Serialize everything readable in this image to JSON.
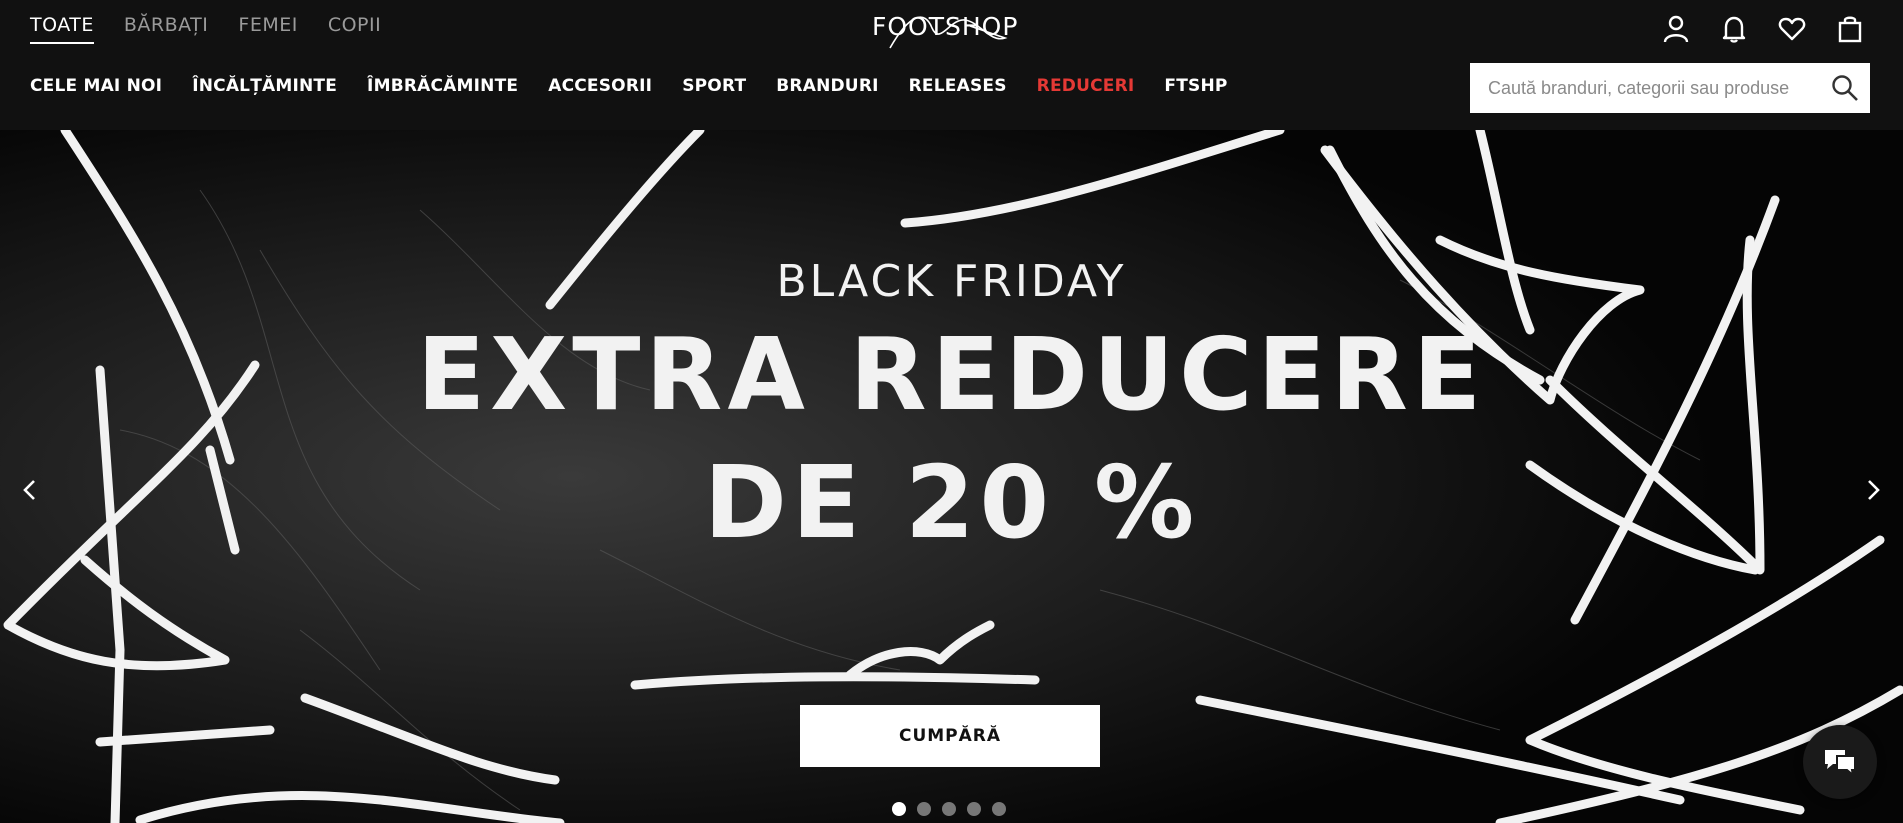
{
  "gender_tabs": [
    {
      "label": "TOATE",
      "active": true
    },
    {
      "label": "BĂRBAȚI",
      "active": false
    },
    {
      "label": "FEMEI",
      "active": false
    },
    {
      "label": "COPII",
      "active": false
    }
  ],
  "logo": {
    "text": "FOOTSHOP"
  },
  "top_icons": [
    "user-icon",
    "bell-icon",
    "heart-icon",
    "bag-icon"
  ],
  "nav": [
    {
      "label": "CELE MAI NOI"
    },
    {
      "label": "ÎNCĂLȚĂMINTE"
    },
    {
      "label": "ÎMBRĂCĂMINTE"
    },
    {
      "label": "ACCESORII"
    },
    {
      "label": "SPORT"
    },
    {
      "label": "BRANDURI"
    },
    {
      "label": "RELEASES"
    },
    {
      "label": "REDUCERI",
      "highlight": "#e53935"
    },
    {
      "label": "FTSHP"
    }
  ],
  "search": {
    "placeholder": "Caută branduri, categorii sau produse",
    "value": ""
  },
  "hero": {
    "line1": "BLACK FRIDAY",
    "line2": "EXTRA REDUCERE",
    "line3": "DE 20 %",
    "cta": "CUMPĂRĂ",
    "slides": 5,
    "active_slide": 1
  },
  "colors": {
    "header_bg": "#111111",
    "sale": "#e53935",
    "hero_bg": "#050505"
  }
}
